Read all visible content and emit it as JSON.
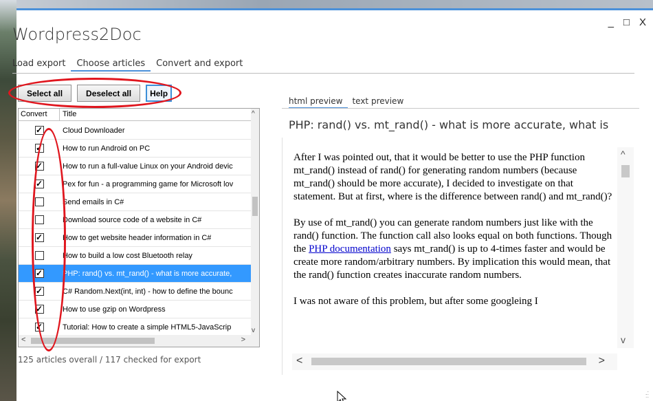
{
  "window": {
    "title": "Wordpress2Doc",
    "minimize": "_",
    "maximize": "□",
    "close": "X"
  },
  "tabs": [
    {
      "label": "Load export"
    },
    {
      "label": "Choose articles",
      "active": true
    },
    {
      "label": "Convert and export"
    }
  ],
  "buttons": {
    "select_all": "Select all",
    "deselect_all": "Deselect all",
    "help": "Help"
  },
  "list": {
    "columns": {
      "convert": "Convert",
      "title": "Title"
    },
    "rows": [
      {
        "checked": true,
        "title": "Cloud Downloader"
      },
      {
        "checked": true,
        "title": "How to run Android on PC"
      },
      {
        "checked": true,
        "title": "How to run a full-value Linux on your Android devic"
      },
      {
        "checked": true,
        "title": "Pex for fun - a programming game for Microsoft lov"
      },
      {
        "checked": false,
        "title": "Send emails in C#"
      },
      {
        "checked": false,
        "title": "Download source code of a website in C#"
      },
      {
        "checked": true,
        "title": "How to get website header information in C#"
      },
      {
        "checked": false,
        "title": "How to build a low cost Bluetooth relay"
      },
      {
        "checked": true,
        "title": "PHP: rand() vs. mt_rand() - what is more accurate,",
        "selected": true
      },
      {
        "checked": true,
        "title": "C# Random.Next(int, int) - how to define the bounc"
      },
      {
        "checked": true,
        "title": "How to use gzip on Wordpress"
      },
      {
        "checked": true,
        "title": "Tutorial: How to create a simple HTML5-JavaScrip"
      }
    ]
  },
  "status": "125 articles overall / 117 checked for export",
  "preview": {
    "tabs": [
      {
        "label": "html preview",
        "active": true
      },
      {
        "label": "text preview"
      }
    ],
    "title": "PHP: rand() vs. mt_rand() - what is more accurate, what is",
    "para1": "After I was pointed out, that it would be better to use the PHP function mt_rand() instead of rand() for generating random numbers (because mt_rand() should be more accurate), I decided to investigate on that statement. But at first, where is the difference between rand() and mt_rand()?",
    "para2_a": "By use of mt_rand() you can generate random numbers just like with the rand() function. The function call also looks equal on both functions. Though the ",
    "para2_link": "PHP documentation",
    "para2_b": " says mt_rand() is up to 4-times faster and would be create more random/arbitrary numbers. By implication this would mean, that the rand() function creates inaccurate random numbers.",
    "para3": "I was not aware of this problem, but after some googleing I"
  },
  "annotation_color": "#e0161e",
  "accent_color": "#3399ff"
}
